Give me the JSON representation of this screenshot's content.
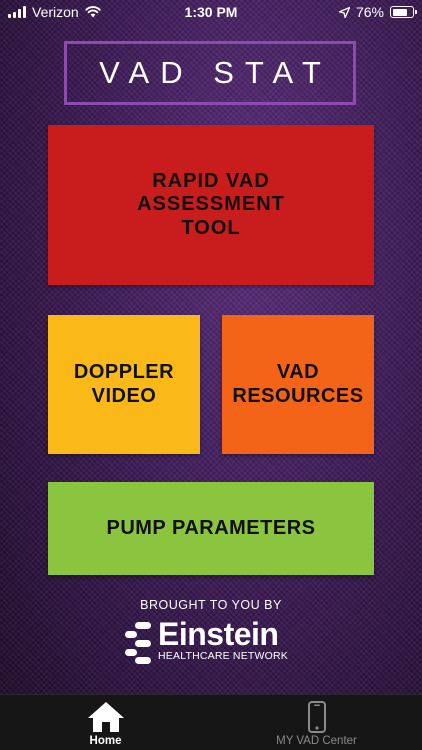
{
  "status_bar": {
    "carrier": "Verizon",
    "time": "1:30 PM",
    "battery": "76%",
    "battery_level": 0.76
  },
  "header": {
    "title": "VAD STAT"
  },
  "tiles": {
    "rapid": "RAPID VAD\nASSESSMENT\nTOOL",
    "doppler": "DOPPLER\nVIDEO",
    "resources": "VAD\nRESOURCES",
    "pump": "PUMP PARAMETERS"
  },
  "footer": {
    "brought_by": "BROUGHT TO YOU BY",
    "logo_name": "Einstein",
    "logo_sub": "HEALTHCARE NETWORK"
  },
  "tab_bar": {
    "home_label": "Home",
    "center_label": "MY VAD Center"
  },
  "icons": [
    "wifi-icon",
    "location-arrow-icon",
    "battery-icon",
    "home-icon",
    "phone-icon"
  ],
  "colors": {
    "rapid": "#c91c1c",
    "doppler": "#fbb919",
    "resources": "#f36418",
    "pump": "#8bc53f",
    "title_border": "#8b4bb0"
  }
}
